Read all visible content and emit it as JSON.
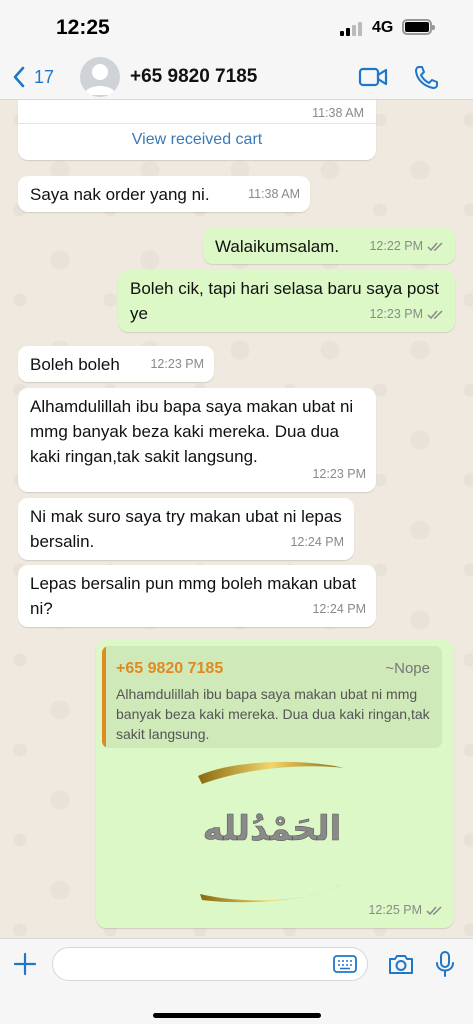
{
  "status_bar": {
    "time": "12:25",
    "network": "4G"
  },
  "header": {
    "back_count": "17",
    "contact_name": "+65 9820 7185",
    "accent": "#1f77c9"
  },
  "chat": {
    "cart": {
      "time": "11:38 AM",
      "link_label": "View received cart"
    },
    "messages": [
      {
        "text": "Saya nak order yang ni.",
        "time": "11:38 AM"
      },
      {
        "text": "Walaikumsalam.",
        "time": "12:22 PM"
      },
      {
        "text": "Boleh cik, tapi hari selasa baru saya post ye",
        "time": "12:23 PM"
      },
      {
        "text": "Boleh boleh",
        "time": "12:23 PM"
      },
      {
        "text": "Alhamdulillah ibu bapa saya makan ubat ni mmg banyak beza kaki mereka. Dua dua kaki ringan,tak sakit langsung.",
        "time": "12:23 PM"
      },
      {
        "text": "Ni mak suro saya try makan ubat ni lepas bersalin.",
        "time": "12:24 PM"
      },
      {
        "text": "Lepas bersalin pun mmg boleh makan ubat ni?",
        "time": "12:24 PM"
      }
    ],
    "reply": {
      "quote_author": "+65 9820 7185",
      "quote_nickname": "~Nope",
      "quote_text": "Alhamdulillah ibu bapa saya makan ubat ni mmg banyak beza kaki mereka. Dua dua kaki ringan,tak sakit langsung.",
      "sticker_text": "الحَمْدُلله",
      "time": "12:25 PM"
    },
    "colors": {
      "incoming": "#ffffff",
      "outgoing": "#dcf8c6",
      "quote_accent": "#e08a22",
      "read_ticks": "#8a8a8a"
    }
  },
  "input_bar": {
    "placeholder": ""
  }
}
